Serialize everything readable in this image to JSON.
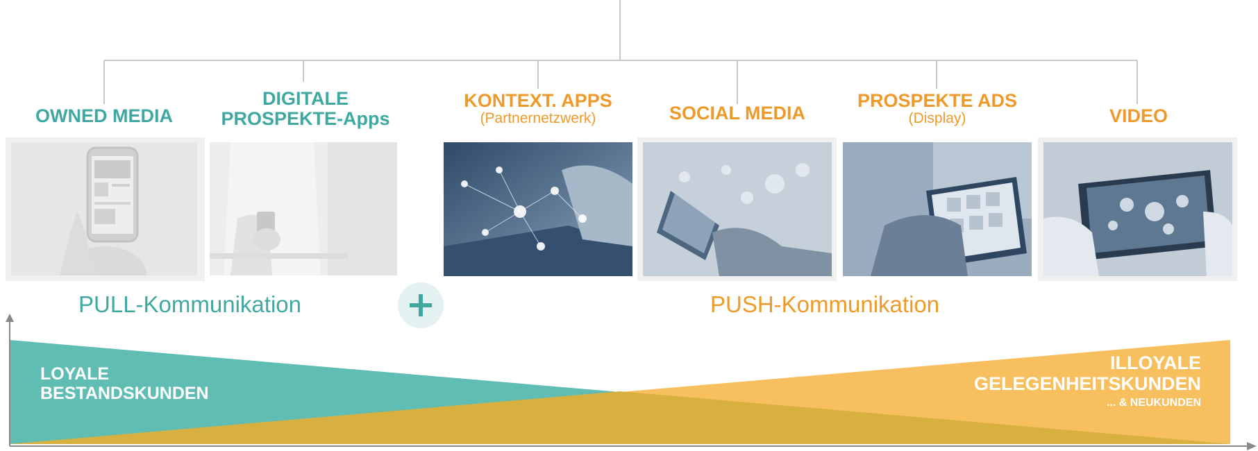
{
  "channels": [
    {
      "title": "OWNED MEDIA",
      "subtitle": "",
      "color": "#3fa9a1",
      "icon": "smartphone-app-photo"
    },
    {
      "title": "DIGITALE PROSPEKTE-Apps",
      "subtitle": "",
      "color": "#3fa9a1",
      "icon": "shopper-with-phone-photo"
    },
    {
      "title": "KONTEXT. APPS",
      "subtitle": "(Partnernetzwerk)",
      "color": "#ee9a2a",
      "icon": "tablet-network-photo"
    },
    {
      "title": "SOCIAL MEDIA",
      "subtitle": "",
      "color": "#ee9a2a",
      "icon": "phone-social-likes-photo"
    },
    {
      "title": "PROSPEKTE ADS",
      "subtitle": "(Display)",
      "color": "#ee9a2a",
      "icon": "tablet-shopping-photo"
    },
    {
      "title": "VIDEO",
      "subtitle": "",
      "color": "#ee9a2a",
      "icon": "phone-video-photo"
    }
  ],
  "communication": {
    "pull": "PULL-Kommunikation",
    "plus": "+",
    "push": "PUSH-Kommunikation"
  },
  "customers": {
    "loyal_line1": "LOYALE",
    "loyal_line2": "BESTANDSKUNDEN",
    "disloyal_line1": "ILLOYALE",
    "disloyal_line2": "GELEGENHEITSKUNDEN",
    "disloyal_line3": "... & NEUKUNDEN"
  },
  "colors": {
    "teal": "#3fa9a1",
    "orange": "#ee9a2a",
    "teal_band": "#5fbdb3",
    "orange_band": "#f8bf5f",
    "overlap": "#d8b040"
  }
}
